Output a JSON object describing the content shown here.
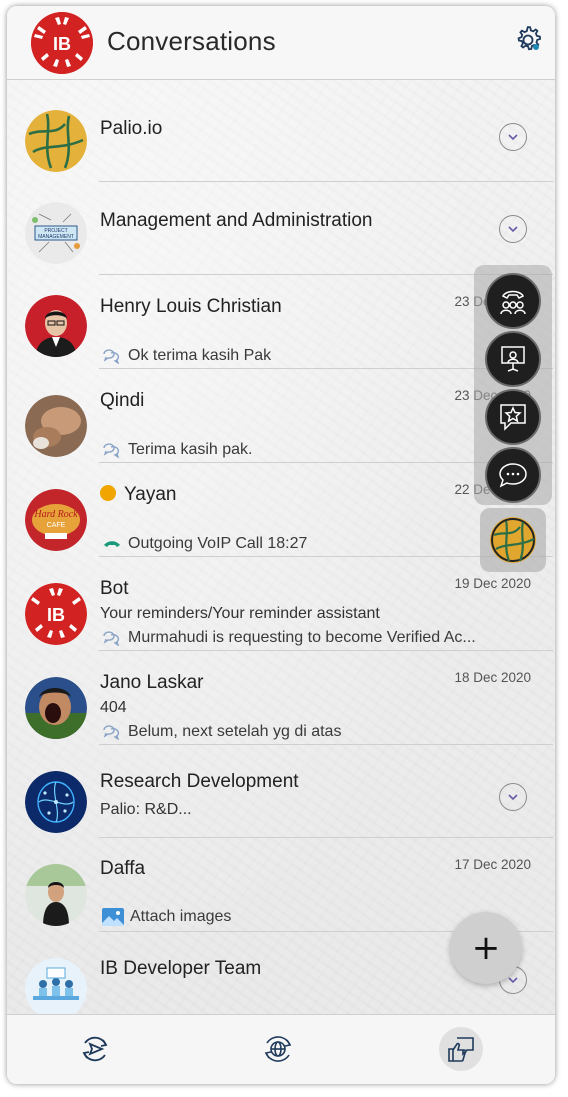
{
  "header": {
    "title": "Conversations",
    "settings_icon": "gear-icon",
    "logo_text": "IB"
  },
  "conversations": [
    {
      "name": "Palio.io",
      "message": "",
      "date": "",
      "type": "group",
      "expand_icon": "chevron-down-icon"
    },
    {
      "name": "Management and Administration",
      "message": "",
      "date": "",
      "type": "group",
      "expand_icon": "chevron-down-icon"
    },
    {
      "name": "Henry Louis Christian",
      "message": "Ok terima kasih Pak",
      "date": "23 Dec 2020",
      "message_icon": "chat-bubble-icon"
    },
    {
      "name": "Qindi",
      "message": "Terima kasih pak.",
      "date": "23 Dec 2020",
      "message_icon": "chat-bubble-icon"
    },
    {
      "name": "Yayan",
      "message": "Outgoing VoIP Call 18:27",
      "date": "22 Dec 2020",
      "message_icon": "phone-outgoing-icon",
      "verified": true
    },
    {
      "name": "Bot",
      "subtitle": "Your reminders/Your reminder assistant",
      "message": "Murmahudi is requesting to become Verified Ac...",
      "date": "19 Dec 2020",
      "message_icon": "chat-bubble-icon"
    },
    {
      "name": "Jano Laskar",
      "subtitle": "404",
      "message": "Belum, next setelah yg di atas",
      "date": "18 Dec 2020",
      "message_icon": "chat-bubble-icon"
    },
    {
      "name": "Research Development",
      "subtitle": "Palio: R&D...",
      "message": "",
      "date": "",
      "type": "group",
      "expand_icon": "chevron-down-icon"
    },
    {
      "name": "Daffa",
      "message": "Attach images",
      "date": "17 Dec 2020",
      "message_icon": "image-icon"
    },
    {
      "name": "IB Developer Team",
      "message": "",
      "date": "",
      "type": "group",
      "expand_icon": "chevron-down-icon"
    }
  ],
  "dock": [
    "conference-call-icon",
    "presentation-icon",
    "starred-chat-icon",
    "chat-dots-icon"
  ],
  "fab": {
    "label": "+"
  },
  "bottom_nav": [
    "send-refresh-icon",
    "globe-refresh-icon",
    "thumbs-up-chat-icon"
  ],
  "colors": {
    "accent_red": "#d32222",
    "call_green": "#1a9a7a",
    "verified_orange": "#f0a500",
    "bubble_blue": "#8aa4c8"
  }
}
